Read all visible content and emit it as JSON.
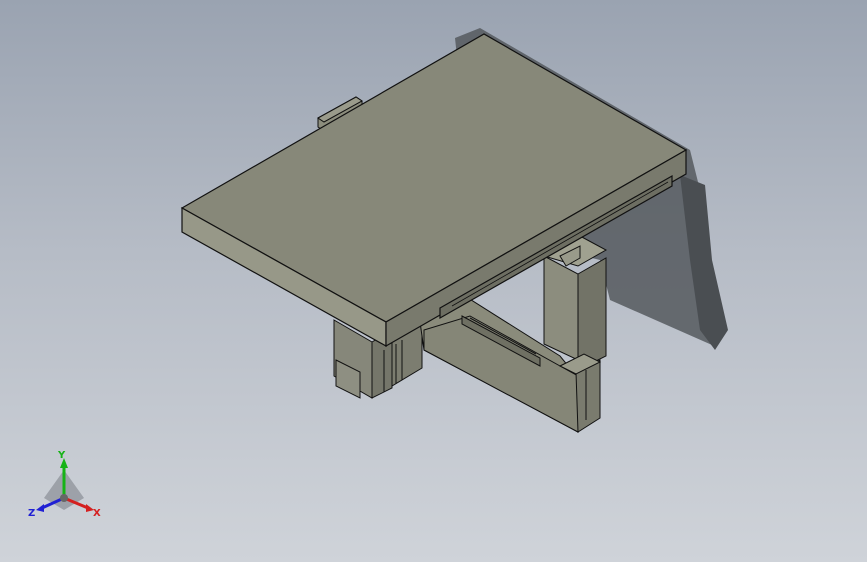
{
  "viewport": {
    "background_top": "#9aa3b1",
    "background_bottom": "#cfd3d9",
    "model_color": "#8a8b7b",
    "edge_color": "#111111",
    "shadow_color": "#4a4e52"
  },
  "triad": {
    "x_label": "X",
    "y_label": "Y",
    "z_label": "Z",
    "x_color": "#d42020",
    "y_color": "#16b316",
    "z_color": "#2020d4"
  }
}
